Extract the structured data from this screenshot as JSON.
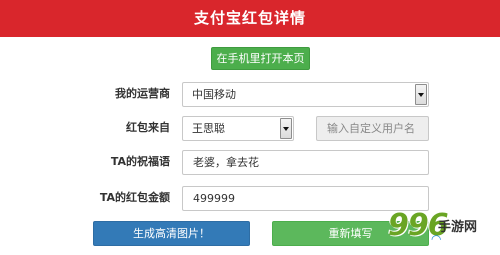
{
  "header": {
    "title": "支付宝红包详情"
  },
  "open_button": {
    "label": "在手机里打开本页"
  },
  "form": {
    "carrier": {
      "label": "我的运营商",
      "value": "中国移动"
    },
    "from": {
      "label": "红包来自",
      "value": "王思聪",
      "custom_placeholder": "输入自定义用户名"
    },
    "blessing": {
      "label": "TA的祝福语",
      "value": "老婆，拿去花"
    },
    "amount": {
      "label": "TA的红包金额",
      "value": "499999"
    }
  },
  "actions": {
    "generate_label": "生成高清图片！",
    "reset_label": "重新填写"
  },
  "watermark": {
    "digits": "996",
    "text": "手游网"
  },
  "colors": {
    "header_bg": "#d9262c",
    "primary_green": "#5cb85c",
    "primary_blue": "#337ab7",
    "watermark_green": "#6aa524"
  }
}
